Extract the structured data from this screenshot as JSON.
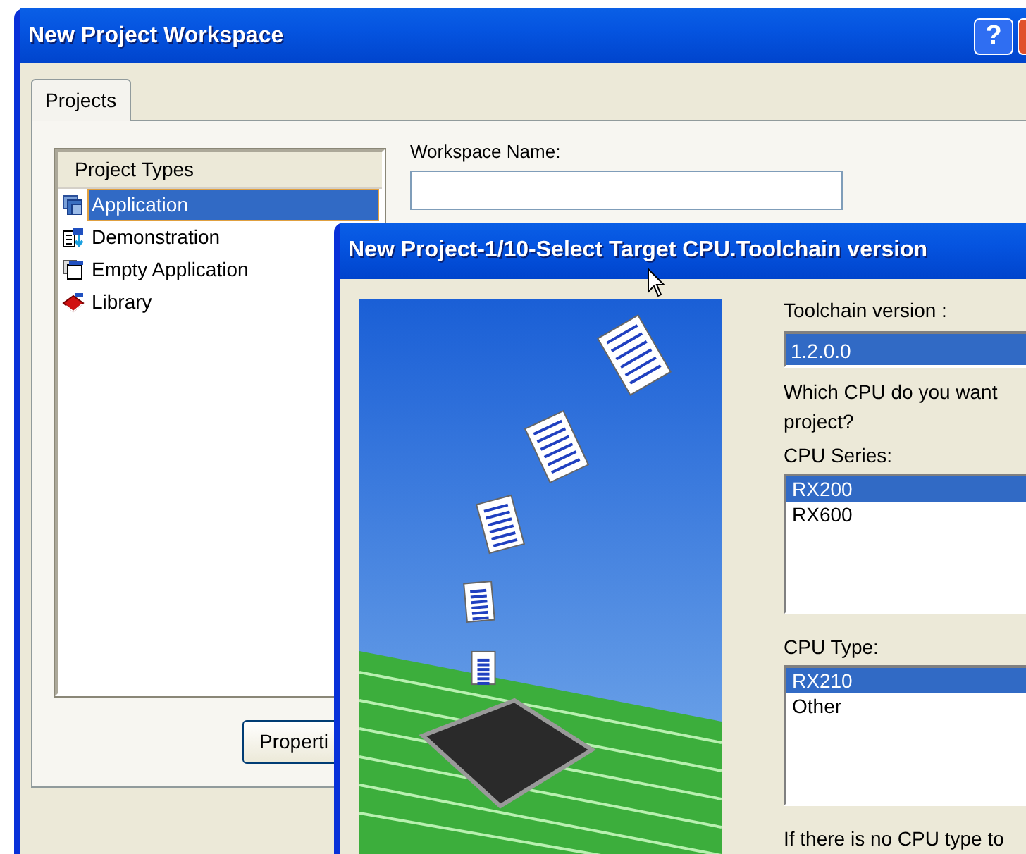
{
  "window": {
    "title": "New Project Workspace",
    "help_button": "?"
  },
  "tabs": [
    {
      "label": "Projects",
      "selected": true
    }
  ],
  "project_types": {
    "header": "Project Types",
    "items": [
      {
        "label": "Application",
        "kind": "application",
        "selected": true
      },
      {
        "label": "Demonstration",
        "kind": "demonstration",
        "selected": false
      },
      {
        "label": "Empty Application",
        "kind": "empty",
        "selected": false
      },
      {
        "label": "Library",
        "kind": "library",
        "selected": false
      }
    ]
  },
  "workspace_name": {
    "label": "Workspace Name:"
  },
  "properties_button": "Properti",
  "wizard": {
    "title": "New Project-1/10-Select Target CPU.Toolchain version",
    "toolchain": {
      "label": "Toolchain version :",
      "value": "1.2.0.0"
    },
    "question_lines": [
      "Which CPU do you want",
      "project?"
    ],
    "cpu_series": {
      "label": "CPU Series:",
      "items": [
        {
          "label": "RX200",
          "selected": true
        },
        {
          "label": "RX600",
          "selected": false
        }
      ]
    },
    "cpu_type": {
      "label": "CPU Type:",
      "items": [
        {
          "label": "RX210",
          "selected": true
        },
        {
          "label": "Other",
          "selected": false
        }
      ]
    },
    "note": "If there is no CPU type to"
  }
}
